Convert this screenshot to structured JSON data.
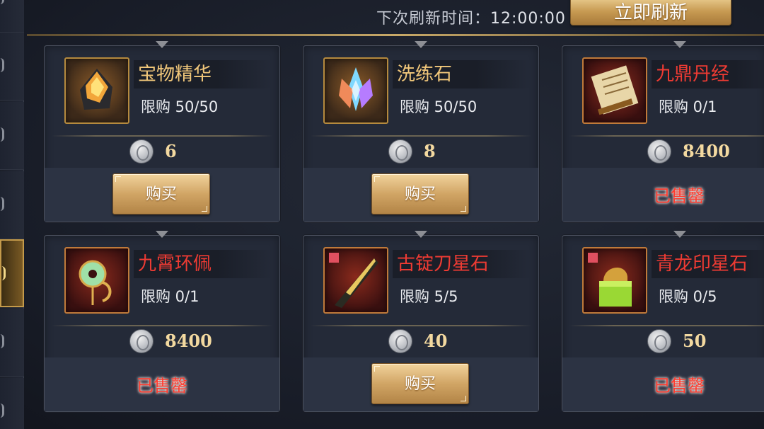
{
  "header": {
    "refresh_label": "下次刷新时间：",
    "refresh_time": "12:00:00",
    "refresh_button": "立即刷新"
  },
  "sidebar": {
    "tabs": [
      {
        "active": false
      },
      {
        "active": false
      },
      {
        "active": false
      },
      {
        "active": true
      },
      {
        "active": false
      },
      {
        "active": false
      }
    ]
  },
  "colors": {
    "name_gold": "#f1c77a",
    "name_red": "#ee3b33",
    "sold_out_red": "#ff3b2e"
  },
  "items": [
    {
      "name": "宝物精华",
      "limit": "限购 50/50",
      "price": "6",
      "action": "购买",
      "name_color": "gold",
      "icon": "treasure-essence-icon",
      "sold_out": false
    },
    {
      "name": "洗练石",
      "limit": "限购 50/50",
      "price": "8",
      "action": "购买",
      "name_color": "gold",
      "icon": "refining-stone-crystal-icon",
      "sold_out": false
    },
    {
      "name": "九鼎丹经",
      "limit": "限购 0/1",
      "price": "8400",
      "action": "已售罄",
      "name_color": "red",
      "icon": "scroll-icon",
      "sold_out": true
    },
    {
      "name": "九霄环佩",
      "limit": "限购 0/1",
      "price": "8400",
      "action": "已售罄",
      "name_color": "red",
      "icon": "jade-pendant-icon",
      "sold_out": true
    },
    {
      "name": "古锭刀星石",
      "limit": "限购 5/5",
      "price": "40",
      "action": "购买",
      "name_color": "red",
      "icon": "blade-star-stone-icon",
      "sold_out": false
    },
    {
      "name": "青龙印星石",
      "limit": "限购 0/5",
      "price": "50",
      "action": "已售罄",
      "name_color": "red",
      "icon": "dragon-seal-star-stone-icon",
      "sold_out": true
    }
  ]
}
